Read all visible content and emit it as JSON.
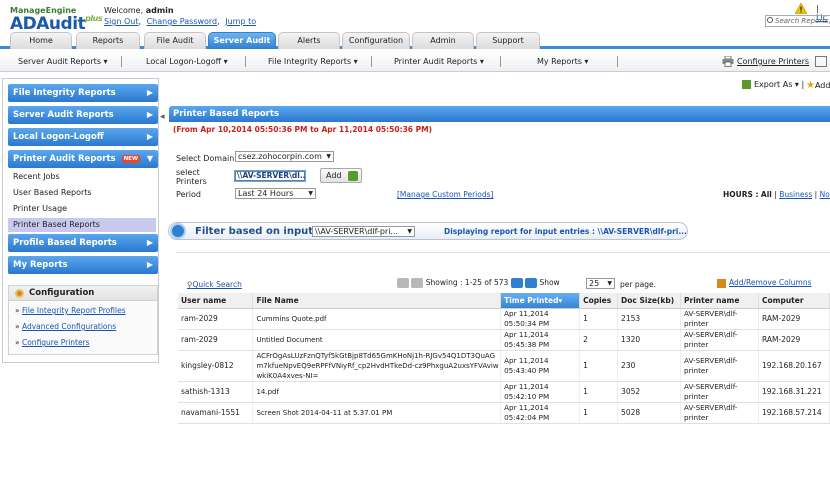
{
  "header": {
    "brand_top": "ManageEngine",
    "brand_main": "ADAudit",
    "brand_plus": "plus",
    "welcome_prefix": "Welcome,",
    "user": "admin",
    "links": [
      "Sign Out",
      "Change Password",
      "Jump to"
    ],
    "license_link": "Lic",
    "search_placeholder": "Search Reports,"
  },
  "tabs": [
    "Home",
    "Reports",
    "File Audit",
    "Server Audit",
    "Alerts",
    "Configuration",
    "Admin",
    "Support"
  ],
  "active_tab": "Server Audit",
  "subnav": {
    "items": [
      "Server Audit Reports ▾",
      "Local Logon-Logoff ▾",
      "File Integrity Reports ▾",
      "Printer Audit Reports ▾",
      "My Reports ▾"
    ],
    "configure_printers": "Configure Printers"
  },
  "sidebar": {
    "groups": [
      "File Integrity Reports",
      "Server Audit Reports",
      "Local Logon-Logoff",
      "Printer Audit Reports",
      "Profile Based Reports",
      "My Reports"
    ],
    "new_badge": "NEW",
    "printer_items": [
      "Recent Jobs",
      "User Based Reports",
      "Printer Usage",
      "Printer Based Reports"
    ],
    "selected_item": "Printer Based Reports",
    "configuration": {
      "title": "Configuration",
      "links": [
        "File Integrity Report Profiles",
        "Advanced Configurations",
        "Configure Printers"
      ]
    }
  },
  "toolbar": {
    "export_label": "Export As ▾",
    "add_label": "Add"
  },
  "report": {
    "title": "Printer Based Reports",
    "date_range": "(From Apr 10,2014 05:50:36 PM to Apr 11,2014 05:50:36 PM)",
    "select_domain_label": "Select Domain",
    "domain_value": "csez.zohocorpin.com",
    "select_printers_label_1": "select",
    "select_printers_label_2": "Printers",
    "printer_value": "\\\\AV-SERVER\\dl...",
    "add_button": "Add",
    "period_label": "Period",
    "period_value": "Last 24 Hours",
    "manage_custom_periods": "[Manage Custom Periods]",
    "hours_label": "HOURS :",
    "hours_all": "All",
    "hours_sep": "|",
    "hours_business": "Business",
    "hours_non": "Nor"
  },
  "filter": {
    "label": "Filter based on inputs",
    "select_value": "\\\\AV-SERVER\\dlf-pri...",
    "displaying_label": "Displaying report for input entries :",
    "displaying_value": "\\\\AV-SERVER\\dlf-pri..."
  },
  "table_controls": {
    "quick_search": "Quick Search",
    "showing": "Showing :",
    "range": "1-25 of 573",
    "show_label": "Show",
    "page_size": "25",
    "per_page": "per page.",
    "add_remove_columns": "Add/Remove Columns"
  },
  "table": {
    "columns": [
      "User name",
      "File Name",
      "Time Printed▾",
      "Copies",
      "Doc Size(kb)",
      "Printer name",
      "Computer"
    ],
    "sorted_column": "Time Printed▾",
    "rows": [
      [
        "ram-2029",
        "Cummins Quote.pdf",
        "Apr 11,2014 05:50:34 PM",
        "1",
        "2153",
        "AV-SERVER\\dlf-printer",
        "RAM-2029"
      ],
      [
        "ram-2029",
        "Untitled Document",
        "Apr 11,2014 05:45:38 PM",
        "2",
        "1320",
        "AV-SERVER\\dlf-printer",
        "RAM-2029"
      ],
      [
        "kingsley-0812",
        "ACFrOgAsLUzFznQTyf5kGtBjp8Td65GmKHoNj1h-RJGv54Q1DT3QuAGm7kfueNpvEQ9eRPFfVNiyRf_cp2HvdHTkeDd-cz9PhxguA2uxsYFVAviwwkiK0A4xves-NI=",
        "Apr 11,2014 05:43:40 PM",
        "1",
        "230",
        "AV-SERVER\\dlf-printer",
        "192.168.20.167"
      ],
      [
        "sathish-1313",
        "14.pdf",
        "Apr 11,2014 05:42:10 PM",
        "1",
        "3052",
        "AV-SERVER\\dlf-printer",
        "192.168.31.221"
      ],
      [
        "navamani-1551",
        "Screen Shot 2014-04-11 at 5.37.01 PM",
        "Apr 11,2014 05:42:04 PM",
        "1",
        "5028",
        "AV-SERVER\\dlf-printer",
        "192.168.57.214"
      ]
    ]
  }
}
